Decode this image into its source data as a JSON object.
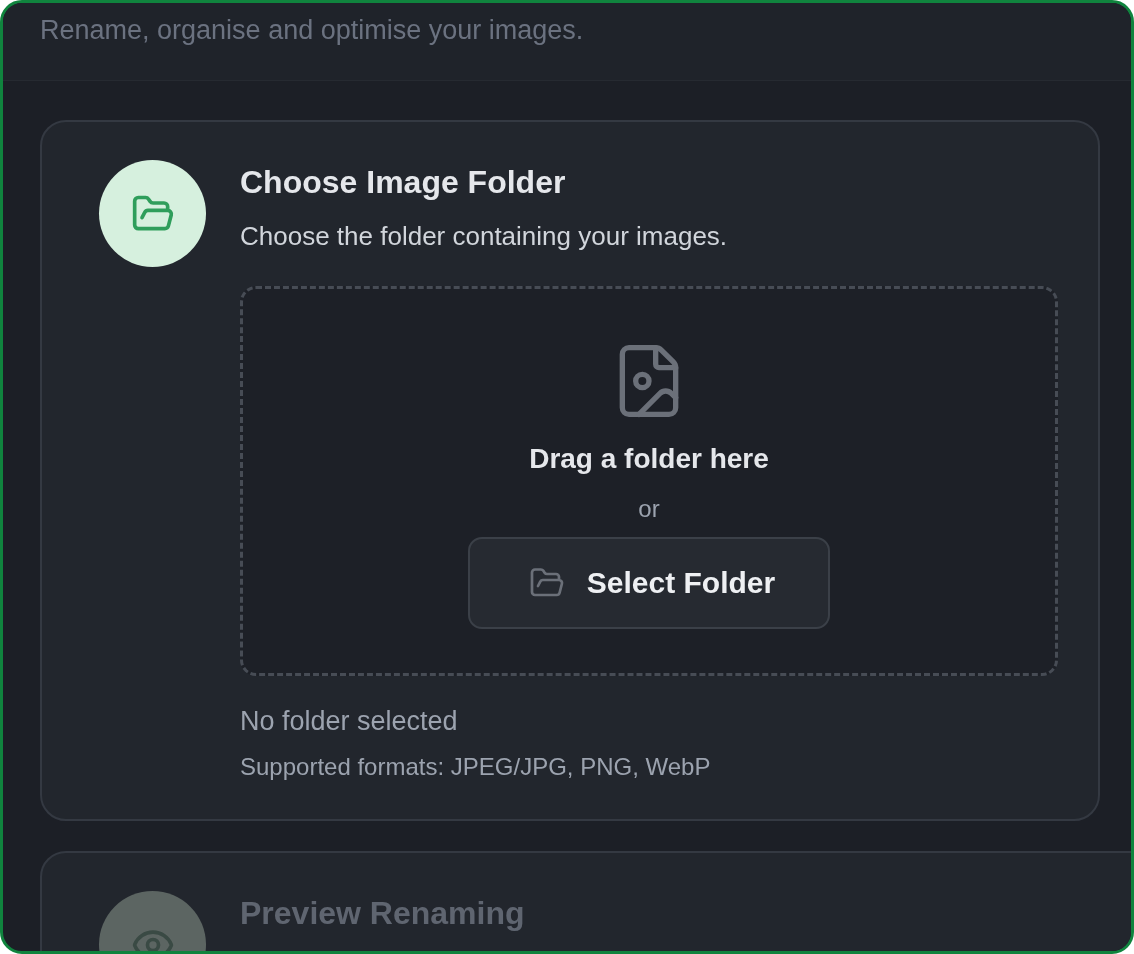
{
  "subtitle": "Rename, organise and optimise your images.",
  "steps": [
    {
      "kind": "upload",
      "active": true,
      "title": "Choose Image Folder",
      "description": "Choose the folder containing your images.",
      "dropzone": {
        "prompt": "Drag a folder here",
        "separator": "or",
        "button": "Select Folder"
      },
      "status": "No folder selected",
      "formats": "Supported formats: JPEG/JPG, PNG, WebP"
    },
    {
      "kind": "preview",
      "active": false,
      "title": "Preview Renaming"
    }
  ]
}
